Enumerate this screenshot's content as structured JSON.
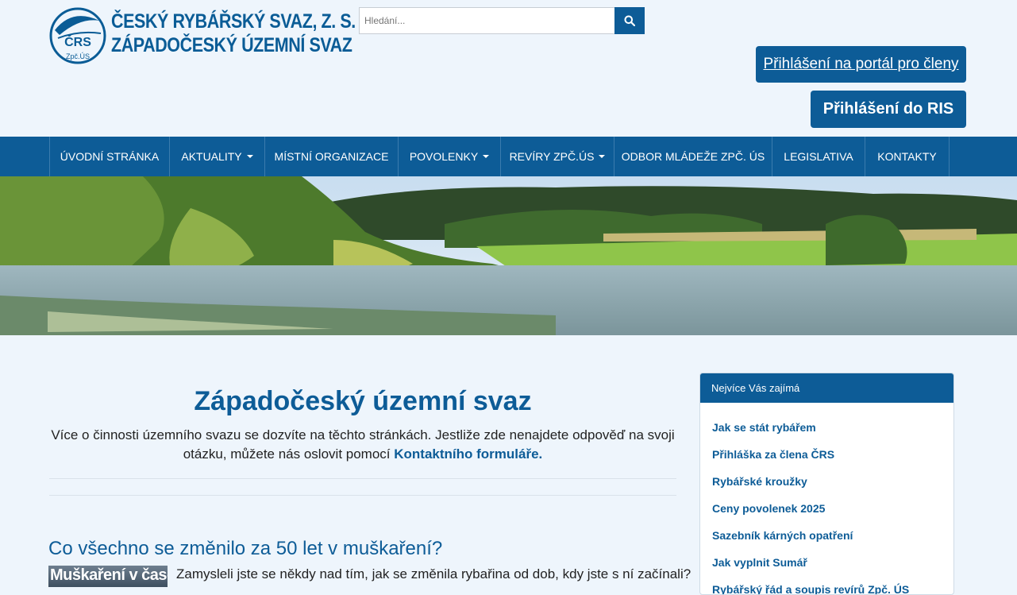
{
  "brand": {
    "line1": "ČESKÝ RYBÁŘSKÝ SVAZ, Z. S.",
    "line2": "ZÁPADOČESKÝ ÚZEMNÍ SVAZ",
    "logo_text": "ČRS",
    "logo_subtext": "Zpč.ÚS",
    "color": "#0a5c96"
  },
  "search": {
    "placeholder": "Hledání...",
    "icon": "search-icon"
  },
  "buttons": {
    "portal": "Přihlášení na portál pro členy",
    "ris": "Přihlášení do RIS"
  },
  "nav": {
    "items": [
      {
        "label": "ÚVODNÍ STRÁNKA",
        "dropdown": false
      },
      {
        "label": "AKTUALITY",
        "dropdown": true
      },
      {
        "label": "MÍSTNÍ ORGANIZACE",
        "dropdown": false
      },
      {
        "label": "POVOLENKY",
        "dropdown": true
      },
      {
        "label": "REVÍRY ZPČ.ÚS",
        "dropdown": true
      },
      {
        "label": "ODBOR MLÁDEŽE ZPČ. ÚS",
        "dropdown": false
      },
      {
        "label": "LEGISLATIVA",
        "dropdown": false
      },
      {
        "label": "KONTAKTY",
        "dropdown": false
      }
    ],
    "background": "#0d5c97"
  },
  "main": {
    "title": "Západočeský územní svaz",
    "intro_text": "Více o činnosti územního svazu se dozvíte na těchto stránkách. Jestliže zde nenajdete odpověď na svoji otázku, můžete nás oslovit pomocí",
    "intro_link": "Kontaktního formuláře."
  },
  "article": {
    "title": "Co všechno se změnilo za 50 let v muškaření?",
    "thumb_text": "Muškaření v čase",
    "excerpt": "Zamysleli jste se někdy nad tím, jak se změnila rybařina od dob, kdy jste s ní začínali?"
  },
  "sidebar": {
    "heading": "Nejvíce Vás zajímá",
    "links": [
      "Jak se stát rybářem",
      "Přihláška za člena ČRS",
      "Rybářské kroužky",
      "Ceny povolenek 2025",
      "Sazebník kárných opatření",
      "Jak vyplnit Sumář",
      "Rybářský řád a soupis revírů Zpč. ÚS"
    ]
  },
  "colors": {
    "page_background": "#eef5fc",
    "accent": "#0d5c97"
  }
}
